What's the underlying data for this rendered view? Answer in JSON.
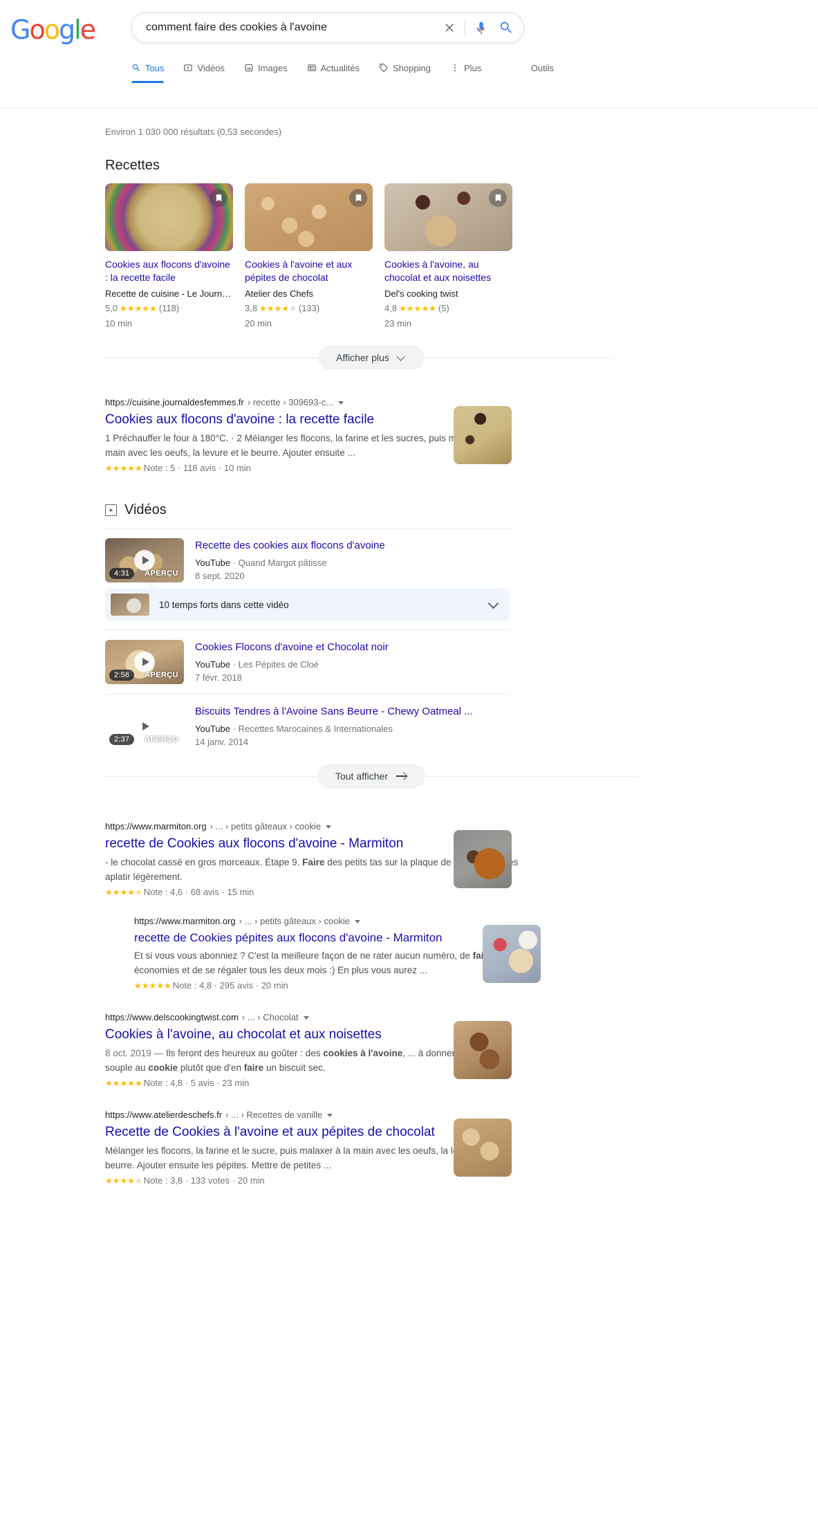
{
  "header": {
    "logo_letters": [
      "G",
      "o",
      "o",
      "g",
      "l",
      "e"
    ],
    "search": {
      "value": "comment faire des cookies à l'avoine",
      "placeholder": "Rechercher",
      "clear_label": "×",
      "mic_name": "microphone-icon",
      "search_name": "search-icon"
    },
    "tabs": [
      {
        "label": "Tous",
        "icon": "search-icon",
        "active": true
      },
      {
        "label": "Vidéos",
        "icon": "video-icon",
        "active": false
      },
      {
        "label": "Images",
        "icon": "image-icon",
        "active": false
      },
      {
        "label": "Actualités",
        "icon": "news-icon",
        "active": false
      },
      {
        "label": "Shopping",
        "icon": "tag-icon",
        "active": false
      },
      {
        "label": "Plus",
        "icon": "more-vertical-icon",
        "active": false
      }
    ],
    "tools_label": "Outils"
  },
  "result_stats": "Environ 1 030 000 résultats (0,53 secondes)",
  "recipes_section": {
    "title": "Recettes",
    "show_more_label": "Afficher plus",
    "cards": [
      {
        "title": "Cookies aux flocons d'avoine : la recette facile",
        "source": "Recette de cuisine - Le Journ…",
        "rating": "5,0",
        "stars_full": 5,
        "reviews": "(118)",
        "time": "10 min",
        "bookmark": "bookmark-icon"
      },
      {
        "title": "Cookies à l'avoine et aux pépites de chocolat",
        "source": "Atelier des Chefs",
        "rating": "3,8",
        "stars_full": 4,
        "reviews": "(133)",
        "time": "20 min",
        "bookmark": "bookmark-icon"
      },
      {
        "title": "Cookies à l'avoine, au chocolat et aux noisettes",
        "source": "Del's cooking twist",
        "rating": "4,8",
        "stars_full": 5,
        "reviews": "(5)",
        "time": "23 min",
        "bookmark": "bookmark-icon"
      }
    ]
  },
  "results": [
    {
      "domain": "https://cuisine.journaldesfemmes.fr",
      "path": "› recette › 309693-c...",
      "title": "Cookies aux flocons d'avoine : la recette facile",
      "snippet": "1 Préchauffer le four à 180°C. · 2 Mélanger les flocons, la farine et les sucres, puis malaxer à la main avec les oeufs, la levure et le beurre. Ajouter ensuite ...",
      "stars_full": 5,
      "meta": "Note : 5 · 118 avis · 10 min",
      "indent": false
    }
  ],
  "videos_section": {
    "title": "Vidéos",
    "show_all_label": "Tout afficher",
    "key_moments_label": "10 temps forts dans cette vidéo",
    "items": [
      {
        "title": "Recette des cookies aux flocons d'avoine",
        "platform": "YouTube",
        "channel": "Quand Margot pâtisse",
        "date": "8 sept. 2020",
        "duration": "4:31",
        "preview_label": "APERÇU"
      },
      {
        "title": "Cookies Flocons d'avoine et Chocolat noir",
        "platform": "YouTube",
        "channel": "Les Pépites de Cloé",
        "date": "7 févr. 2018",
        "duration": "2:56",
        "preview_label": "APERÇU"
      },
      {
        "title": "Biscuits Tendres à l'Avoine Sans Beurre - Chewy Oatmeal ...",
        "platform": "YouTube",
        "channel": "Recettes Marocaines & Internationales",
        "date": "14 janv. 2014",
        "duration": "2:37",
        "preview_label": "APERÇU"
      }
    ]
  },
  "results_bottom": [
    {
      "domain": "https://www.marmiton.org",
      "path": "› ... › petits gâteaux › cookie",
      "title": "recette de Cookies aux flocons d'avoine - Marmiton",
      "snippet_parts": [
        {
          "t": "- le chocolat cassé en gros morceaux. Étape 9. ",
          "b": false
        },
        {
          "t": "Faire",
          "b": true
        },
        {
          "t": " des petits tas sur la plaque de votre four et les aplatir légèrement.",
          "b": false
        }
      ],
      "stars_full": 4,
      "stars_half": true,
      "meta": "Note : 4,6 · 68 avis · 15 min",
      "indent": false
    },
    {
      "domain": "https://www.marmiton.org",
      "path": "› ... › petits gâteaux › cookie",
      "title": "recette de Cookies pépites aux flocons d'avoine - Marmiton",
      "snippet_parts": [
        {
          "t": "Et si vous vous abonniez ? C'est la meilleure façon de ne rater aucun numéro, de ",
          "b": false
        },
        {
          "t": "faire",
          "b": true
        },
        {
          "t": " des économies et de se régaler tous les deux mois :) En plus vous aurez ...",
          "b": false
        }
      ],
      "stars_full": 5,
      "stars_half": false,
      "meta": "Note : 4,8 · 295 avis · 20 min",
      "indent": true
    },
    {
      "domain": "https://www.delscookingtwist.com",
      "path": "› ... › Chocolat",
      "title": "Cookies à l'avoine, au chocolat et aux noisettes",
      "snippet_parts": [
        {
          "t": "8 oct. 2019 — ",
          "b": false,
          "date": true
        },
        {
          "t": "Ils feront des heureux au goûter : des ",
          "b": false
        },
        {
          "t": "cookies à l'avoine",
          "b": true
        },
        {
          "t": ", ... à donner cette texture souple au ",
          "b": false
        },
        {
          "t": "cookie",
          "b": true
        },
        {
          "t": " plutôt que d'en ",
          "b": false
        },
        {
          "t": "faire",
          "b": true
        },
        {
          "t": " un biscuit sec.",
          "b": false
        }
      ],
      "stars_full": 5,
      "stars_half": false,
      "meta": "Note : 4,8 · 5 avis · 23 min",
      "indent": false
    },
    {
      "domain": "https://www.atelierdeschefs.fr",
      "path": "› ... › Recettes de vanille",
      "title": "Recette de Cookies à l'avoine et aux pépites de chocolat",
      "snippet_parts": [
        {
          "t": "Mélanger les flocons, la farine et le sucre, puis malaxer à la main avec les oeufs, la levure et le beurre. Ajouter ensuite les pépites. Mettre de petites ...",
          "b": false
        }
      ],
      "stars_full": 4,
      "stars_half": false,
      "meta": "Note : 3,8 · 133 votes · 20 min",
      "indent": false
    }
  ],
  "colors": {
    "link": "#1a0dab",
    "accent": "#1a73e8",
    "star": "#fbbc04",
    "text_secondary": "#70757a"
  }
}
